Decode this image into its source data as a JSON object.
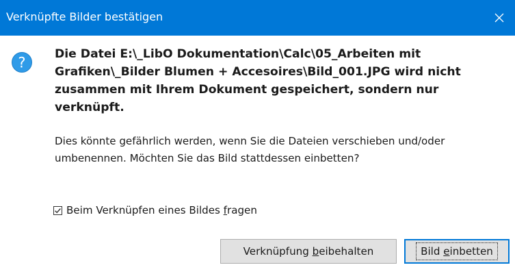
{
  "window": {
    "title": "Verknüpfte Bilder bestätigen",
    "close_icon": "close-icon"
  },
  "message": {
    "icon": "question-icon",
    "primary": "Die Datei E:\\_LibO Dokumentation\\Calc\\05_Arbeiten mit Grafiken\\_Bilder Blumen + Accesoires\\Bild_001.JPG wird nicht zusammen mit Ihrem Dokument gespeichert, sondern nur verknüpft.",
    "secondary": "Dies könnte gefährlich werden, wenn Sie die Dateien verschieben und/oder umbenennen. Möchten Sie das Bild stattdessen einbetten?"
  },
  "ask_checkbox": {
    "checked": true,
    "label_before": "Beim Verknüpfen eines Bildes ",
    "label_mnemonic": "f",
    "label_after": "ragen"
  },
  "buttons": {
    "keep": {
      "before": "Verknüpfung ",
      "mnemonic": "b",
      "after": "eibehalten"
    },
    "embed": {
      "before": "Bild ",
      "mnemonic": "e",
      "after": "inbetten"
    }
  },
  "colors": {
    "titlebar": "#0078d7",
    "icon_fill": "#2f9be8",
    "button_face": "#e1e1e1"
  }
}
